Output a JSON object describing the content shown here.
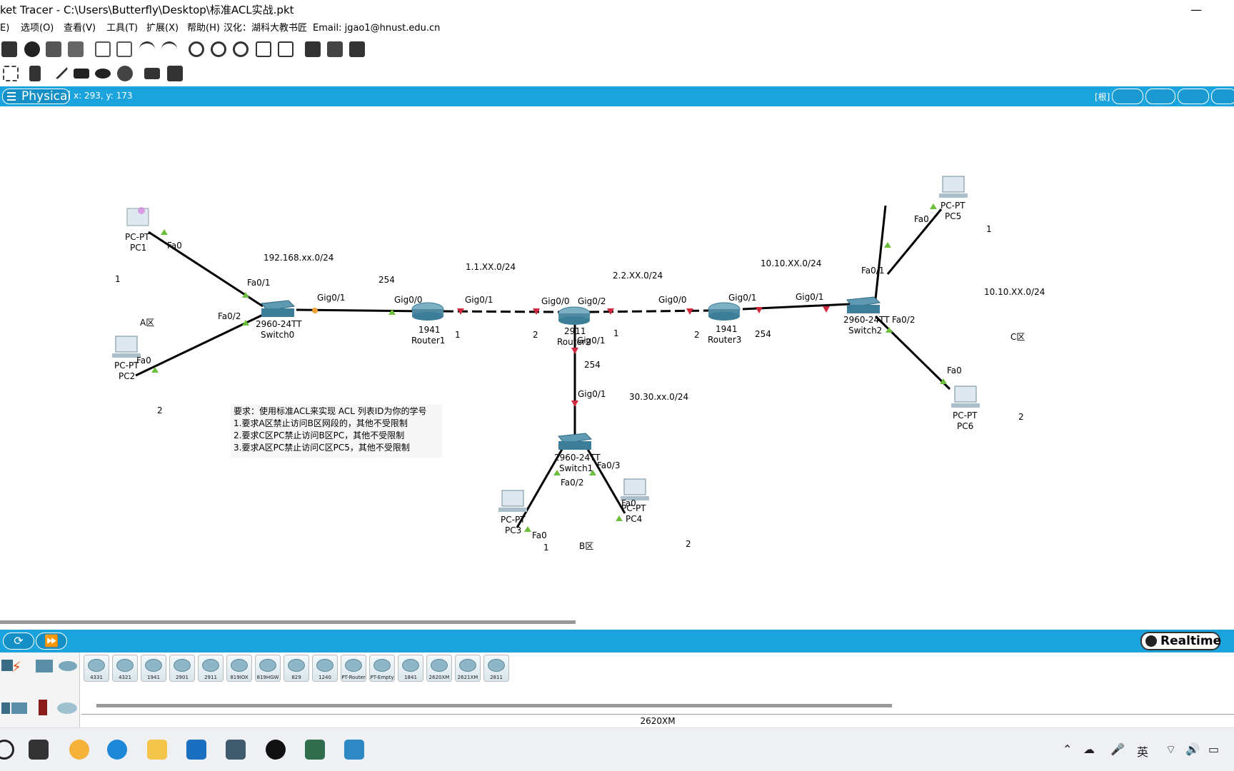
{
  "window": {
    "title": "ket Tracer - C:\\Users\\Butterfly\\Desktop\\标准ACL实战.pkt",
    "minimize_glyph": "—",
    "maximize_glyph": "□"
  },
  "menu": {
    "items": [
      "E)",
      "选项(O)",
      "查看(V)",
      "工具(T)",
      "扩展(X)",
      "帮助(H)",
      "汉化：湖科大教书匠",
      "Email: jgao1@hnust.edu.cn"
    ]
  },
  "workspace": {
    "mode_label": "Physical",
    "coords": "x: 293, y: 173",
    "root_label": "[根]"
  },
  "topology": {
    "devices": [
      {
        "id": "pc1",
        "type": "PC-PT",
        "name": "PC1",
        "icon": "laptop-icon"
      },
      {
        "id": "pc2",
        "type": "PC-PT",
        "name": "PC2",
        "icon": "pc-icon"
      },
      {
        "id": "pc3",
        "type": "PC-PT",
        "name": "PC3",
        "icon": "pc-icon"
      },
      {
        "id": "pc4",
        "type": "PC-PT",
        "name": "PC4",
        "icon": "pc-icon"
      },
      {
        "id": "pc5",
        "type": "PC-PT",
        "name": "PC5",
        "icon": "pc-icon"
      },
      {
        "id": "pc6",
        "type": "PC-PT",
        "name": "PC6",
        "icon": "pc-icon"
      },
      {
        "id": "switch0",
        "type": "2960-24TT",
        "name": "Switch0",
        "icon": "switch-icon"
      },
      {
        "id": "switch1",
        "type": "2960-24TT",
        "name": "Switch1",
        "icon": "switch-icon"
      },
      {
        "id": "switch2",
        "type": "2960-24TT",
        "name": "Switch2",
        "icon": "switch-icon"
      },
      {
        "id": "router1",
        "type": "1941",
        "name": "Router1",
        "icon": "router-icon"
      },
      {
        "id": "router2",
        "type": "2911",
        "name": "Router2",
        "icon": "router-icon"
      },
      {
        "id": "router3",
        "type": "1941",
        "name": "Router3",
        "icon": "router-icon"
      }
    ],
    "port_labels": [
      "Fa0",
      "Fa0/1",
      "Fa0/2",
      "Fa0",
      "Gig0/1",
      "Gig0/0",
      "Gig0/1",
      "Gig0/0",
      "Gig0/2",
      "Gig0/1",
      "Gig0/0",
      "Gig0/1",
      "Gig0/1",
      "Gig0/1",
      "Fa0/1",
      "Fa0",
      "Fa0/2",
      "Fa0",
      "Fa0/2",
      "Fa0/3",
      "Fa0",
      "Fa0"
    ],
    "network_labels": [
      "192.168.xx.0/24",
      "1.1.XX.0/24",
      "2.2.XX.0/24",
      "10.10.XX.0/24",
      "10.10.XX.0/24",
      "30.30.xx.0/24"
    ],
    "host_numbers": [
      "1",
      "2",
      "254",
      "1",
      "2",
      "1",
      "2",
      "254",
      "254",
      "1",
      "2",
      "1",
      "2",
      "1",
      "2"
    ],
    "zone_labels": [
      "A区",
      "B区",
      "C区"
    ],
    "note": [
      "要求：使用标准ACL来实现 ACL 列表ID为你的学号",
      "1.要求A区禁止访问B区网段的，其他不受限制",
      "2.要求C区PC禁止访问B区PC，其他不受限制",
      "3.要求A区PC禁止访问C区PC5，其他不受限制"
    ]
  },
  "bottom": {
    "mode": "Realtime",
    "devices": [
      "4331",
      "4321",
      "1941",
      "2901",
      "2911",
      "819IOX",
      "819HGW",
      "829",
      "1240",
      "PT-Router",
      "PT-Empty",
      "1841",
      "2620XM",
      "2621XM",
      "2811"
    ],
    "selected_device": "2620XM"
  },
  "colors": {
    "accent": "#1aa3dc",
    "link_up": "#6cbf3a",
    "link_down": "#d0283c",
    "cable": "#000000"
  }
}
